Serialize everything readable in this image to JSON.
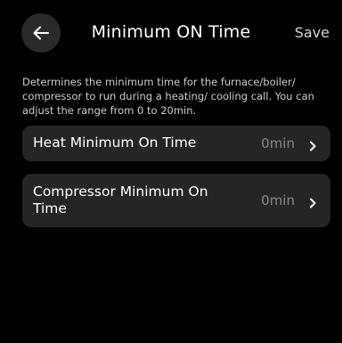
{
  "header": {
    "title": "Minimum ON Time",
    "save_label": "Save",
    "back_icon": "arrow-left-icon"
  },
  "description": "Determines the minimum time for the furnace/boiler/ compressor to run during a heating/ cooling call. You can adjust the range from 0 to 20min.",
  "settings": [
    {
      "label": "Heat Minimum On Time",
      "value": "0min",
      "icon": "chevron-right-icon"
    },
    {
      "label": "Compressor Minimum On Time",
      "value": "0min",
      "icon": "chevron-right-icon"
    }
  ],
  "colors": {
    "background": "#000000",
    "card": "#252525",
    "back_button": "#2a2a2a",
    "value_text": "#8a8a8a"
  }
}
